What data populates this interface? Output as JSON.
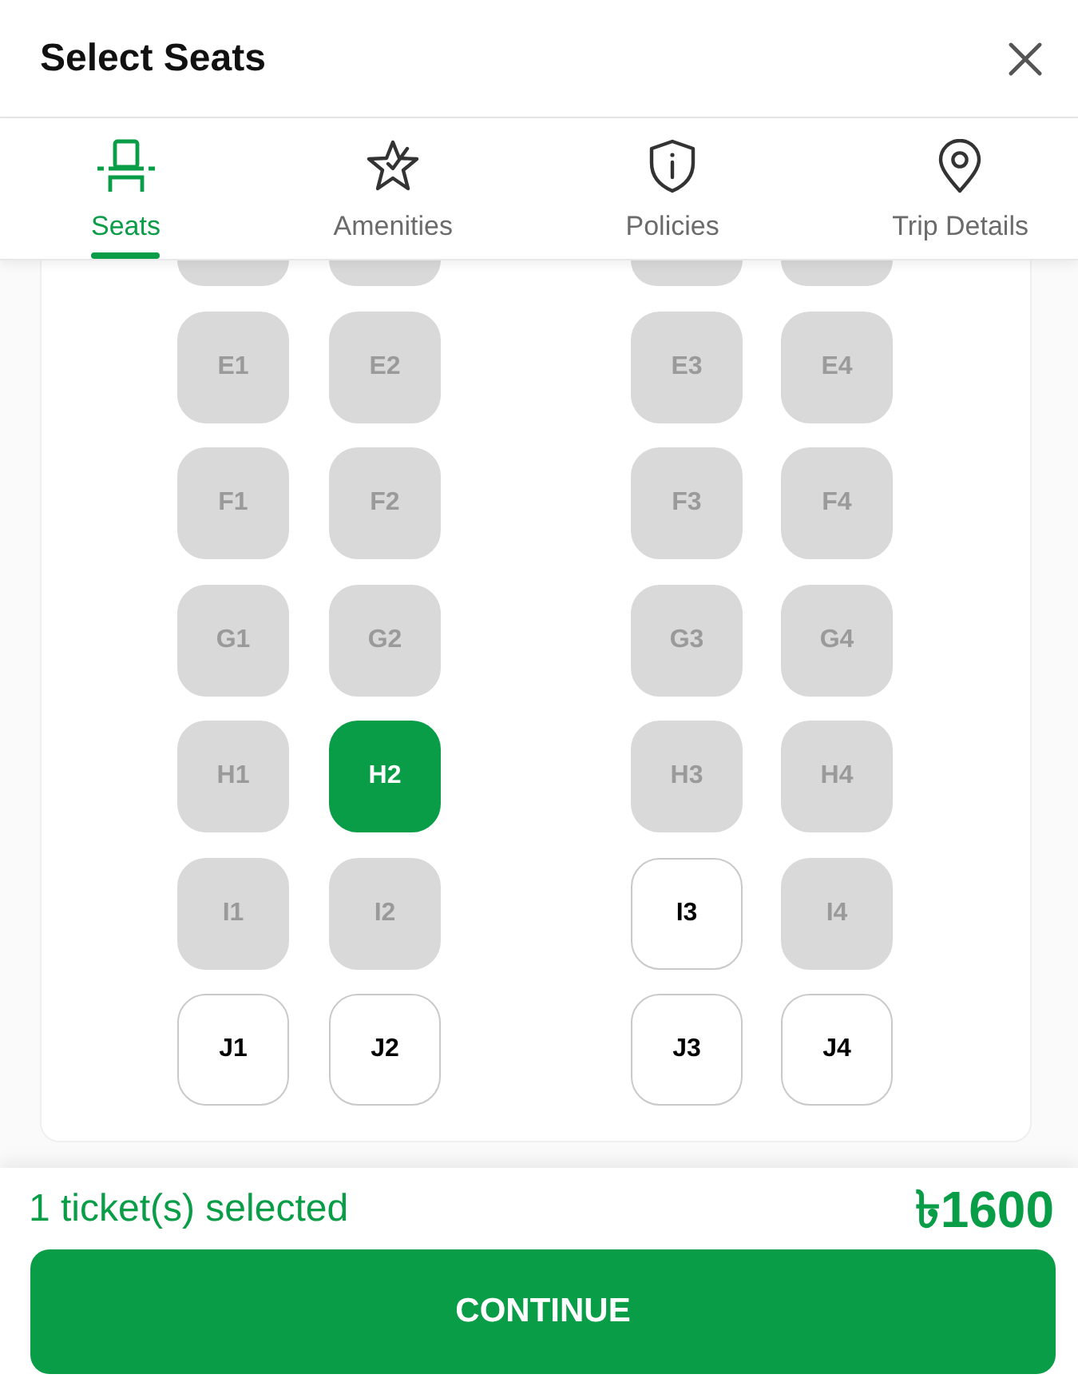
{
  "header": {
    "title": "Select Seats"
  },
  "tabs": [
    {
      "label": "Seats",
      "selected": true
    },
    {
      "label": "Amenities",
      "selected": false
    },
    {
      "label": "Policies",
      "selected": false
    },
    {
      "label": "Trip Details",
      "selected": false
    }
  ],
  "seat_map": {
    "rows": [
      {
        "partial": true,
        "seats": [
          {
            "booked": true,
            "selected": false
          },
          {
            "booked": true,
            "selected": false
          },
          {
            "booked": true,
            "selected": false
          },
          {
            "booked": true,
            "selected": false
          }
        ]
      },
      {
        "partial": false,
        "seats": [
          {
            "label": "E1",
            "booked": true,
            "selected": false
          },
          {
            "label": "E2",
            "booked": true,
            "selected": false
          },
          {
            "label": "E3",
            "booked": true,
            "selected": false
          },
          {
            "label": "E4",
            "booked": true,
            "selected": false
          }
        ]
      },
      {
        "partial": false,
        "seats": [
          {
            "label": "F1",
            "booked": true,
            "selected": false
          },
          {
            "label": "F2",
            "booked": true,
            "selected": false
          },
          {
            "label": "F3",
            "booked": true,
            "selected": false
          },
          {
            "label": "F4",
            "booked": true,
            "selected": false
          }
        ]
      },
      {
        "partial": false,
        "seats": [
          {
            "label": "G1",
            "booked": true,
            "selected": false
          },
          {
            "label": "G2",
            "booked": true,
            "selected": false
          },
          {
            "label": "G3",
            "booked": true,
            "selected": false
          },
          {
            "label": "G4",
            "booked": true,
            "selected": false
          }
        ]
      },
      {
        "partial": false,
        "seats": [
          {
            "label": "H1",
            "booked": true,
            "selected": false
          },
          {
            "label": "H2",
            "booked": false,
            "selected": true
          },
          {
            "label": "H3",
            "booked": true,
            "selected": false
          },
          {
            "label": "H4",
            "booked": true,
            "selected": false
          }
        ]
      },
      {
        "partial": false,
        "seats": [
          {
            "label": "I1",
            "booked": true,
            "selected": false
          },
          {
            "label": "I2",
            "booked": true,
            "selected": false
          },
          {
            "label": "I3",
            "booked": false,
            "selected": false
          },
          {
            "label": "I4",
            "booked": true,
            "selected": false
          }
        ]
      },
      {
        "partial": false,
        "seats": [
          {
            "label": "J1",
            "booked": false,
            "selected": false
          },
          {
            "label": "J2",
            "booked": false,
            "selected": false
          },
          {
            "label": "J3",
            "booked": false,
            "selected": false
          },
          {
            "label": "J4",
            "booked": false,
            "selected": false
          }
        ]
      }
    ]
  },
  "footer": {
    "summary": "1 ticket(s) selected",
    "total": "৳1600",
    "button": "CONTINUE"
  }
}
